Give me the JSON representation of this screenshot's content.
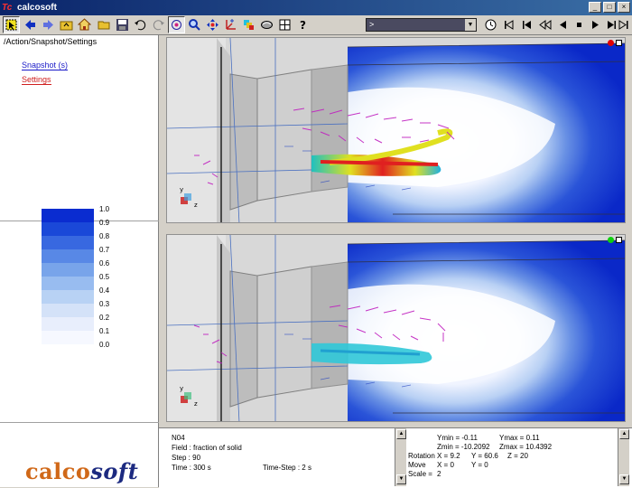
{
  "window": {
    "title": "calcosoft",
    "minimize": "_",
    "maximize": "□",
    "close": "×"
  },
  "toolbar": {
    "combo_value": ">",
    "icons": [
      "select-icon",
      "back-arrow-icon",
      "forward-arrow-icon",
      "folder-up-icon",
      "home-icon",
      "open-folder-icon",
      "save-icon",
      "undo-icon",
      "redo-icon",
      "rotate-view-icon",
      "zoom-icon",
      "pan-icon",
      "axes-icon",
      "layers-icon",
      "cut-plane-icon",
      "grid-icon",
      "help-icon"
    ],
    "media": [
      "clock-icon",
      "first-frame-icon",
      "step-back-icon",
      "rewind-icon",
      "play-back-icon",
      "stop-icon",
      "play-icon",
      "step-forward-icon",
      "last-frame-icon"
    ]
  },
  "left_panel": {
    "path": "/Action/Snapshot/Settings",
    "snapshot_link": "Snapshot (s)",
    "settings_link": "Settings"
  },
  "legend": {
    "labels": [
      "1.0",
      "0.9",
      "0.8",
      "0.7",
      "0.6",
      "0.5",
      "0.4",
      "0.3",
      "0.2",
      "0.1",
      "0.0"
    ],
    "colors": [
      "#0a2cd0",
      "#1a48d8",
      "#3868e0",
      "#5888e6",
      "#78a4ea",
      "#98bcf0",
      "#b8d2f4",
      "#d4e2f8",
      "#e8eefc",
      "#f6f8ff"
    ]
  },
  "logo": {
    "part1": "calco",
    "part2": "soft"
  },
  "viewports": {
    "top_indicator_color": "#e00000",
    "bottom_indicator_color": "#10d010",
    "axis_label": "z",
    "axis_label_y": "y"
  },
  "status": {
    "model": "N04",
    "field": "Field :  fraction of solid",
    "step": "Step : 90",
    "time": "Time : 300 s",
    "time_step": "Time-Step : 2 s",
    "ymin": "Ymin = -0.11",
    "ymax": "Ymax = 0.11",
    "zmin": "Zmin = -10.2092",
    "zmax": "Zmax = 10.4392",
    "rotation_label": "Rotation",
    "rot_x": "X = 9.2",
    "rot_y": "Y = 60.6",
    "rot_z": "Z = 20",
    "move_label": "Move",
    "move_x": "X = 0",
    "move_y": "Y = 0",
    "scale_label": "Scale =",
    "scale_val": "2"
  }
}
